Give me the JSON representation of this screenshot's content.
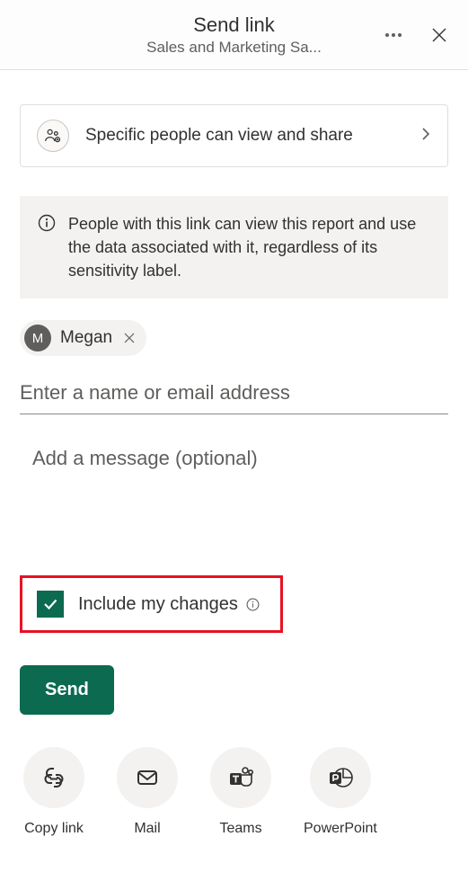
{
  "header": {
    "title": "Send link",
    "subtitle": "Sales and Marketing Sa..."
  },
  "linkSettings": {
    "text": "Specific people can view and share"
  },
  "infoBanner": {
    "text": "People with this link can view this report and use the data associated with it, regardless of its sensitivity label."
  },
  "recipient": {
    "initial": "M",
    "name": "Megan"
  },
  "nameInput": {
    "placeholder": "Enter a name or email address"
  },
  "messageInput": {
    "placeholder": "Add a message (optional)"
  },
  "includeChanges": {
    "label": "Include my changes",
    "checked": true
  },
  "sendButton": {
    "label": "Send"
  },
  "shareOptions": [
    {
      "label": "Copy link"
    },
    {
      "label": "Mail"
    },
    {
      "label": "Teams"
    },
    {
      "label": "PowerPoint"
    }
  ]
}
